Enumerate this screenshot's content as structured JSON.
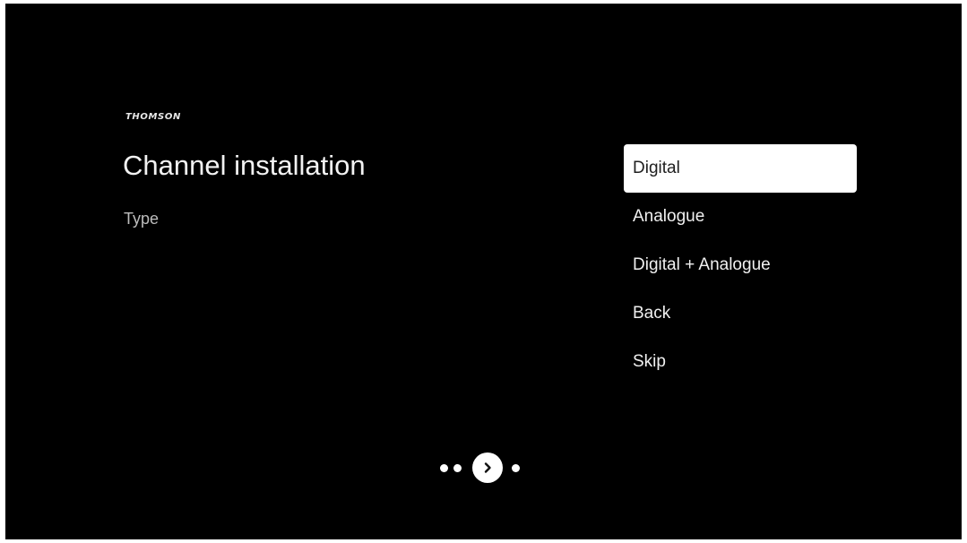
{
  "brand": {
    "name": "THOMSON"
  },
  "screen": {
    "title": "Channel installation",
    "subtitle": "Type"
  },
  "menu": {
    "items": [
      {
        "label": "Digital",
        "selected": true
      },
      {
        "label": "Analogue",
        "selected": false
      },
      {
        "label": "Digital + Analogue",
        "selected": false
      },
      {
        "label": "Back",
        "selected": false
      },
      {
        "label": "Skip",
        "selected": false
      }
    ]
  },
  "pager": {
    "next_icon": "chevron-right-icon"
  },
  "colors": {
    "background": "#000000",
    "selected_item_background": "#ffffff",
    "selected_item_text": "#202020",
    "text": "#f0f0f0",
    "subtitle_text": "#bdbdbd"
  }
}
